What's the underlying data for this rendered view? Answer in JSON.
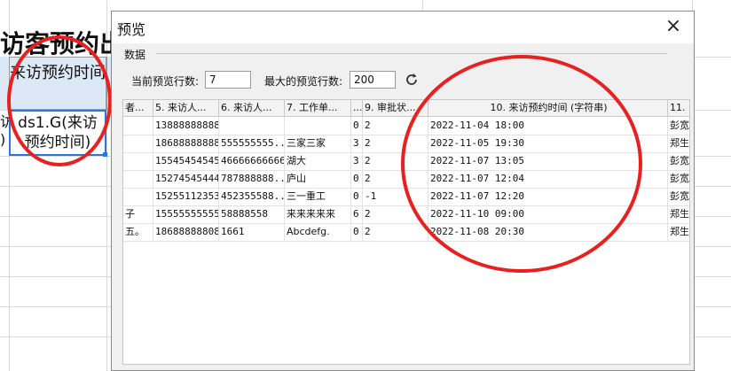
{
  "sheet": {
    "title_fragment": "访客预约出",
    "header_cell": "来访预约时间",
    "header_left_fragment": "",
    "selected_cell": "ds1.G(来访预约时间)",
    "left_cell_fragment": "访 )"
  },
  "dialog": {
    "title": "预览",
    "close_label": "×",
    "group_label": "数据",
    "current_rows_label": "当前预览行数:",
    "current_rows_value": "7",
    "max_rows_label": "最大的预览行数:",
    "max_rows_value": "200",
    "refresh_icon": "refresh-icon",
    "columns": [
      "者...",
      "5. 来访人...",
      "6. 来访人...",
      "7. 工作单...",
      "...",
      "9. 审批状...",
      "10. 来访预约时间 (字符串)",
      "11."
    ],
    "rows": [
      [
        "",
        "13888888888",
        "",
        "",
        "0",
        "2",
        "2022-11-04 18:00",
        "彭宽"
      ],
      [
        "",
        "18688888888",
        "555555555...",
        "三家三家",
        "3",
        "2",
        "2022-11-05 19:30",
        "郑生"
      ],
      [
        "",
        "15545454545",
        "466666666666",
        "湖大",
        "3",
        "2",
        "2022-11-07 13:05",
        "彭宽"
      ],
      [
        "",
        "15274545444",
        "787888888...",
        "庐山",
        "0",
        "2",
        "2022-11-07 12:04",
        "彭宽"
      ],
      [
        "",
        "15255112353",
        "452355588...",
        "三一重工",
        "0",
        "-1",
        "2022-11-07 12:20",
        "彭宽"
      ],
      [
        "子",
        "15555555555",
        "58888558",
        "来来来来来",
        "6",
        "2",
        "2022-11-10 09:00",
        "郑生"
      ],
      [
        "五。",
        "18688888808",
        "1661",
        "Abcdefg.",
        "0",
        "2",
        "2022-11-08 20:30",
        "郑生"
      ]
    ]
  },
  "colors": {
    "annotation_red": "#e8201f",
    "selection_blue": "#2b78d0",
    "header_fill": "#dce8f5"
  }
}
